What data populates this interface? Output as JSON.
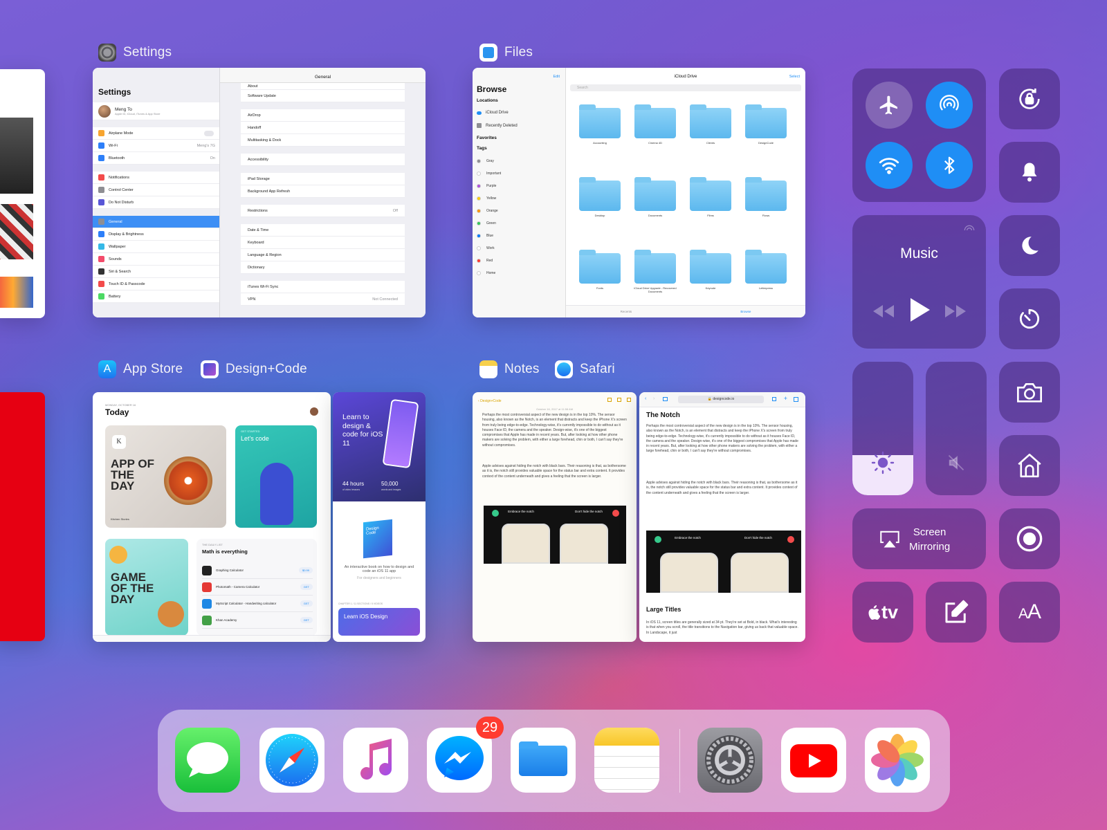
{
  "switcher": {
    "apps": [
      {
        "name": "Settings"
      },
      {
        "name": "Files"
      },
      {
        "name": "App Store"
      },
      {
        "name": "Design+Code"
      },
      {
        "name": "Notes"
      },
      {
        "name": "Safari"
      }
    ]
  },
  "settings": {
    "sidebar_title": "Settings",
    "user_name": "Meng To",
    "user_sub": "Apple ID, iCloud, iTunes & App Store",
    "sidebar_items": [
      "Airplane Mode",
      "Wi-Fi",
      "Bluetooth",
      "Notifications",
      "Control Center",
      "Do Not Disturb",
      "General",
      "Display & Brightness",
      "Wallpaper",
      "Sounds",
      "Siri & Search",
      "Touch ID & Passcode",
      "Battery"
    ],
    "wifi_value": "Meng's 7G",
    "bluetooth_value": "On",
    "main_title": "General",
    "main_items": [
      "About",
      "Software Update",
      "AirDrop",
      "Handoff",
      "Multitasking & Dock",
      "Accessibility",
      "iPad Storage",
      "Background App Refresh",
      "Restrictions",
      "Date & Time",
      "Keyboard",
      "Language & Region",
      "Dictionary",
      "iTunes Wi-Fi Sync",
      "VPN"
    ],
    "restrictions_value": "Off",
    "vpn_value": "Not Connected"
  },
  "files": {
    "edit": "Edit",
    "browse": "Browse",
    "locations": "Locations",
    "location_items": [
      "iCloud Drive",
      "Recently Deleted"
    ],
    "favorites": "Favorites",
    "tags": "Tags",
    "tag_items": [
      "Gray",
      "Important",
      "Purple",
      "Yellow",
      "Orange",
      "Green",
      "Blue",
      "Work",
      "Red",
      "Home"
    ],
    "header": "iCloud Drive",
    "select": "Select",
    "search": "Search",
    "folders": [
      "Accounting",
      "Cinema 4D",
      "Clients",
      "DesignCode",
      "Desktop",
      "Documents",
      "Films",
      "Flows",
      "Fonts",
      "iCloud Drive Upgrade - Recovered Documents",
      "Keynote",
      "Letterpress"
    ],
    "tabs": [
      "Recents",
      "Browse"
    ]
  },
  "appstore": {
    "date": "MONDAY, OCTOBER 16",
    "today": "Today",
    "app_of_day": "APP OF THE DAY",
    "app_of_day_name": "Kitchen Stories",
    "lets_code_tag": "GET STARTED",
    "lets_code": "Let's code",
    "game_of_day": "GAME OF THE DAY",
    "list_tag": "THE DAILY LIST",
    "list_title": "Math is everything",
    "list_items": [
      {
        "name": "Graphing Calculator",
        "btn": "$0.99"
      },
      {
        "name": "Photomath - Camera Calculator",
        "btn": "GET"
      },
      {
        "name": "MyScript Calculator - Handwriting calculator",
        "btn": "GET"
      },
      {
        "name": "Khan Academy",
        "btn": "GET"
      }
    ]
  },
  "designcode": {
    "hero": "Learn to design & code for iOS 11",
    "stat1": "44 hours",
    "stat1_sub": "of video lessons",
    "stat2": "50,000",
    "stat2_sub": "words and images",
    "book_label": "Design Code",
    "desc": "An interactive book on how to design and code an iOS 11 app",
    "sub": "For designers and beginners",
    "chapter": "CHAPTER 1 / 11 SECTIONS / 5 VIDEOS",
    "chapter_title": "Learn iOS Design"
  },
  "notes": {
    "back": "Design+Code",
    "date": "October 16, 2017 at 11:58 AM",
    "body": "Perhaps the most controversial aspect of the new design is in the top 10%. The sensor housing, also known as the Notch, is an element that distracts and keep the iPhone X's screen from truly being edge-to-edge. Technology-wise, it's currently impossible to do without as it houses Face ID, the camera and the speaker. Design-wise, it's one of the biggest compromises that Apple has made in recent years. But, after looking at how other phone makers are solving the problem, with either a large forehead, chin or both, I can't say they're without compromises.",
    "body2": "Apple advises against hiding the notch with black bars. Their reasoning is that, as bothersome as it is, the notch still provides valuable space for the status bar and extra content. It provides context of the content underneath and gives a feeling that the screen is larger.",
    "embrace": "Embrace the notch",
    "dont_hide": "Don't hide the notch"
  },
  "safari": {
    "url": "designcode.io",
    "title": "The Notch",
    "section2": "Large Titles",
    "section2_body": "In iOS 11, screen titles are generally sized at 34 pt. They're set at Bold, in black. What's interesting is that when you scroll, the title transitions to the Navigation bar, giving us back that valuable space. In Landscape, it just"
  },
  "control_center": {
    "music_title": "Music",
    "screen_mirroring_line1": "Screen",
    "screen_mirroring_line2": "Mirroring",
    "apple_tv": "tv",
    "text_size": "AA",
    "brightness_level": 0.3,
    "volume_level": 0.0
  },
  "dock": {
    "apps": [
      "Messages",
      "Safari",
      "Music",
      "Messenger",
      "Files",
      "Notes",
      "Settings",
      "YouTube",
      "Photos"
    ],
    "messenger_badge": "29"
  },
  "colors": {
    "system_blue": "#1f8ef5",
    "badge_red": "#ff3b30",
    "settings_highlight": "#3d8ff5"
  }
}
